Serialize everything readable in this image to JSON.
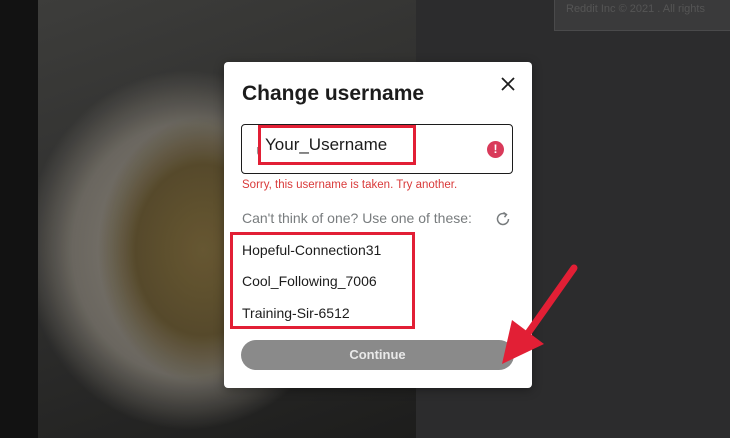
{
  "background": {
    "copyright": "Reddit Inc © 2021 . All rights"
  },
  "modal": {
    "title": "Change username",
    "input": {
      "prefix": "u/",
      "value": "Your_Username"
    },
    "error": "Sorry, this username is taken. Try another.",
    "suggestions_label": "Can't think of one? Use one of these:",
    "suggestions": [
      "Hopeful-Connection31",
      "Cool_Following_7006",
      "Training-Sir-6512"
    ],
    "continue_label": "Continue"
  },
  "icons": {
    "close": "close-icon",
    "error": "error-icon",
    "refresh": "refresh-icon"
  },
  "colors": {
    "highlight": "#e21f35",
    "error": "#d93a3a",
    "button_disabled": "#8a8a8a"
  }
}
